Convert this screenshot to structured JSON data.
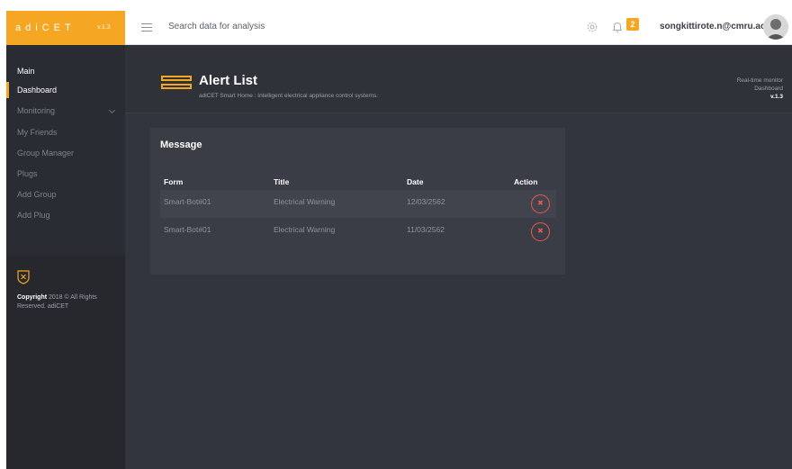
{
  "brand": {
    "name": "adiCET",
    "version": "v.1.3",
    "accent": "#f5a623"
  },
  "topbar": {
    "search_placeholder": "Search data for analysis",
    "notification_count": "2",
    "user_email": "songkittirote.n@cmru.ac.th"
  },
  "sidebar": {
    "heading": "Main",
    "items": [
      {
        "label": "Dashboard",
        "active": true
      },
      {
        "label": "Monitoring"
      },
      {
        "label": "My Friends"
      },
      {
        "label": "Group Manager"
      },
      {
        "label": "Plugs"
      },
      {
        "label": "Add Group"
      },
      {
        "label": "Add Plug"
      }
    ],
    "copyright_bold": "Copyright",
    "copyright_rest": " 2018 © All Rights Reserved. adiCET"
  },
  "header": {
    "title": "Alert List",
    "subtitle": "adiCET Smart Home : Intelligent electrical appliance control systems.",
    "monitor_label": "Real-time monitor",
    "monitor_page": "Dashboard",
    "monitor_version": "v.1.3"
  },
  "card": {
    "title": "Message",
    "columns": [
      "Form",
      "Title",
      "Date",
      "Action"
    ],
    "rows": [
      {
        "form": "Smart-Bot#01",
        "title": "Electrical Warning",
        "date": "12/03/2562"
      },
      {
        "form": "Smart-Bot#01",
        "title": "Electrical Warning",
        "date": "11/03/2562"
      }
    ]
  }
}
